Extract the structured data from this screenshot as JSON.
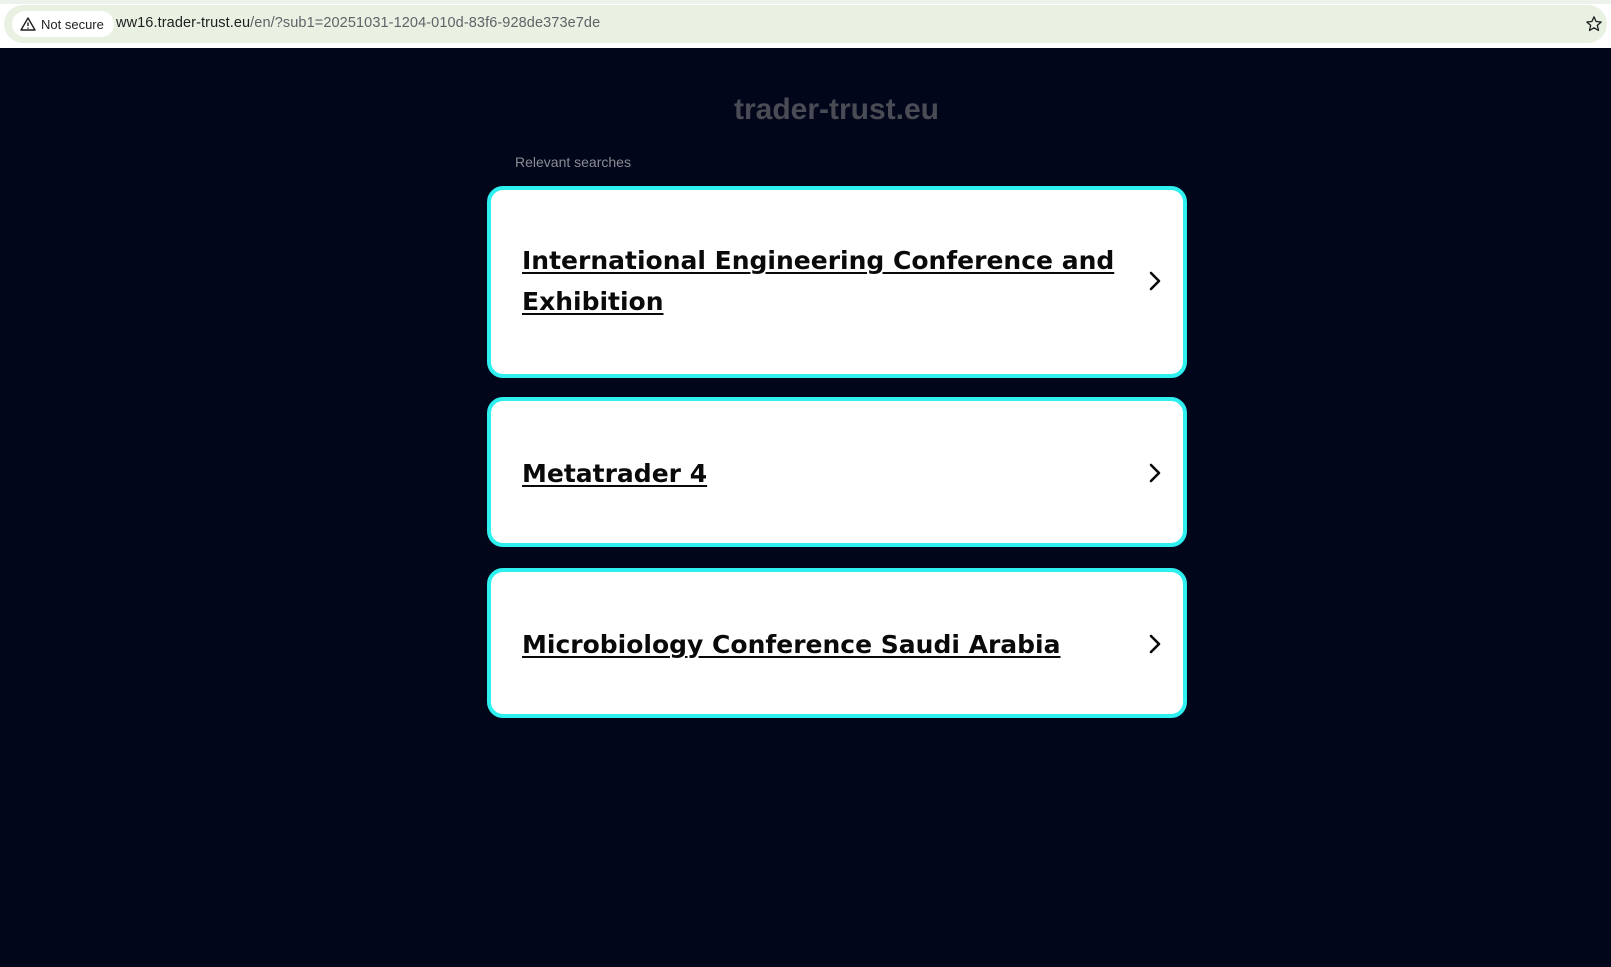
{
  "browser": {
    "security_label": "Not secure",
    "url_host": "ww16.trader-trust.eu",
    "url_path": "/en/?sub1=20251031-1204-010d-83f6-928de373e7de"
  },
  "page": {
    "site_title": "trader-trust.eu",
    "section_label": "Relevant searches",
    "results": [
      {
        "label": "International Engineering Conference and Exhibition"
      },
      {
        "label": "Metatrader 4"
      },
      {
        "label": "Microbiology Conference Saudi Arabia"
      }
    ]
  },
  "colors": {
    "background": "#02061a",
    "card_border": "#2ef0ef",
    "card_fill": "#ffffff",
    "title": "#4a4c55"
  },
  "icons": {
    "security": "warning-triangle-icon",
    "bookmark": "star-outline-icon",
    "result_arrow": "chevron-right-icon"
  }
}
